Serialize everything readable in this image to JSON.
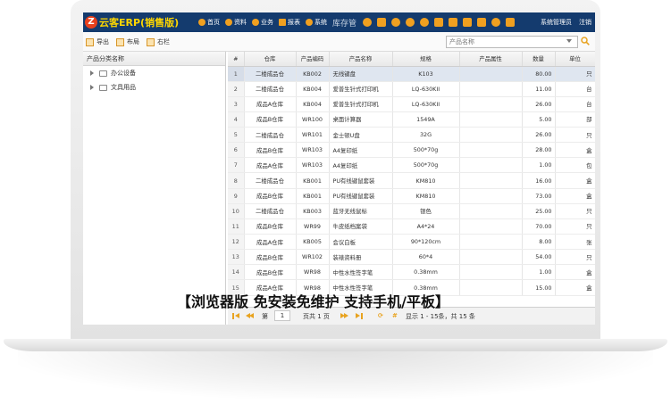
{
  "app": {
    "logo_badge": "Z",
    "logo_text": "云客ERP(销售版)",
    "nav": [
      {
        "label": "首页",
        "icon": "home-icon"
      },
      {
        "label": "资料",
        "icon": "book-icon"
      },
      {
        "label": "业务",
        "icon": "plus-icon"
      },
      {
        "label": "报表",
        "icon": "chart-icon"
      },
      {
        "label": "系统",
        "icon": "gear-icon"
      }
    ],
    "current_module": "库存管",
    "user_label": "系统管理员",
    "logout_label": "注销"
  },
  "toolbar": {
    "export_label": "导出",
    "layout_label": "布局",
    "columns_label": "右栏",
    "search_placeholder": "产品名称"
  },
  "tree": {
    "header": "产品分类名称",
    "nodes": [
      "办公设备",
      "文具用品"
    ]
  },
  "grid": {
    "columns": [
      "#",
      "仓库",
      "产品编码",
      "产品名称",
      "规格",
      "产品属性",
      "数量",
      "单位"
    ],
    "rows": [
      [
        "1",
        "二楼成品仓",
        "KB002",
        "无线键盘",
        "K103",
        "",
        "80.00",
        "只"
      ],
      [
        "2",
        "二楼成品仓",
        "KB004",
        "爱普生针式打印机",
        "LQ-630KII",
        "",
        "11.00",
        "台"
      ],
      [
        "3",
        "成品A仓库",
        "KB004",
        "爱普生针式打印机",
        "LQ-630KII",
        "",
        "26.00",
        "台"
      ],
      [
        "4",
        "成品B仓库",
        "WR100",
        "桌面计算器",
        "1549A",
        "",
        "5.00",
        "部"
      ],
      [
        "5",
        "二楼成品仓",
        "WR101",
        "金士顿U盘",
        "32G",
        "",
        "26.00",
        "只"
      ],
      [
        "6",
        "成品B仓库",
        "WR103",
        "A4复印纸",
        "500*70g",
        "",
        "28.00",
        "盒"
      ],
      [
        "7",
        "成品A仓库",
        "WR103",
        "A4复印纸",
        "500*70g",
        "",
        "1.00",
        "包"
      ],
      [
        "8",
        "二楼成品仓",
        "KB001",
        "PU有线键鼠套装",
        "KM810",
        "",
        "16.00",
        "盒"
      ],
      [
        "9",
        "成品B仓库",
        "KB001",
        "PU有线键鼠套装",
        "KM810",
        "",
        "73.00",
        "盒"
      ],
      [
        "10",
        "二楼成品仓",
        "KB003",
        "蓝牙无线鼠标",
        "银色",
        "",
        "25.00",
        "只"
      ],
      [
        "11",
        "成品B仓库",
        "WR99",
        "牛皮纸档案袋",
        "A4*24",
        "",
        "70.00",
        "只"
      ],
      [
        "12",
        "成品A仓库",
        "KB005",
        "会议白板",
        "90*120cm",
        "",
        "8.00",
        "张"
      ],
      [
        "13",
        "成品B仓库",
        "WR102",
        "装裱资料册",
        "60*4",
        "",
        "54.00",
        "只"
      ],
      [
        "14",
        "成品B仓库",
        "WR98",
        "中性水性签字笔",
        "0.38mm",
        "",
        "1.00",
        "盒"
      ],
      [
        "15",
        "成品A仓库",
        "WR98",
        "中性水性签字笔",
        "0.38mm",
        "",
        "15.00",
        "盒"
      ]
    ]
  },
  "pager": {
    "page_prefix": "第",
    "page_value": "1",
    "page_suffix": "页共 1 页",
    "summary": "显示 1 - 15条，共 15 条"
  },
  "caption": "【浏览器版 免安装免维护 支持手机/平板】",
  "colors": {
    "topbar": "#143b6e",
    "accent": "#e8a320",
    "logo_text": "#ffd700"
  }
}
